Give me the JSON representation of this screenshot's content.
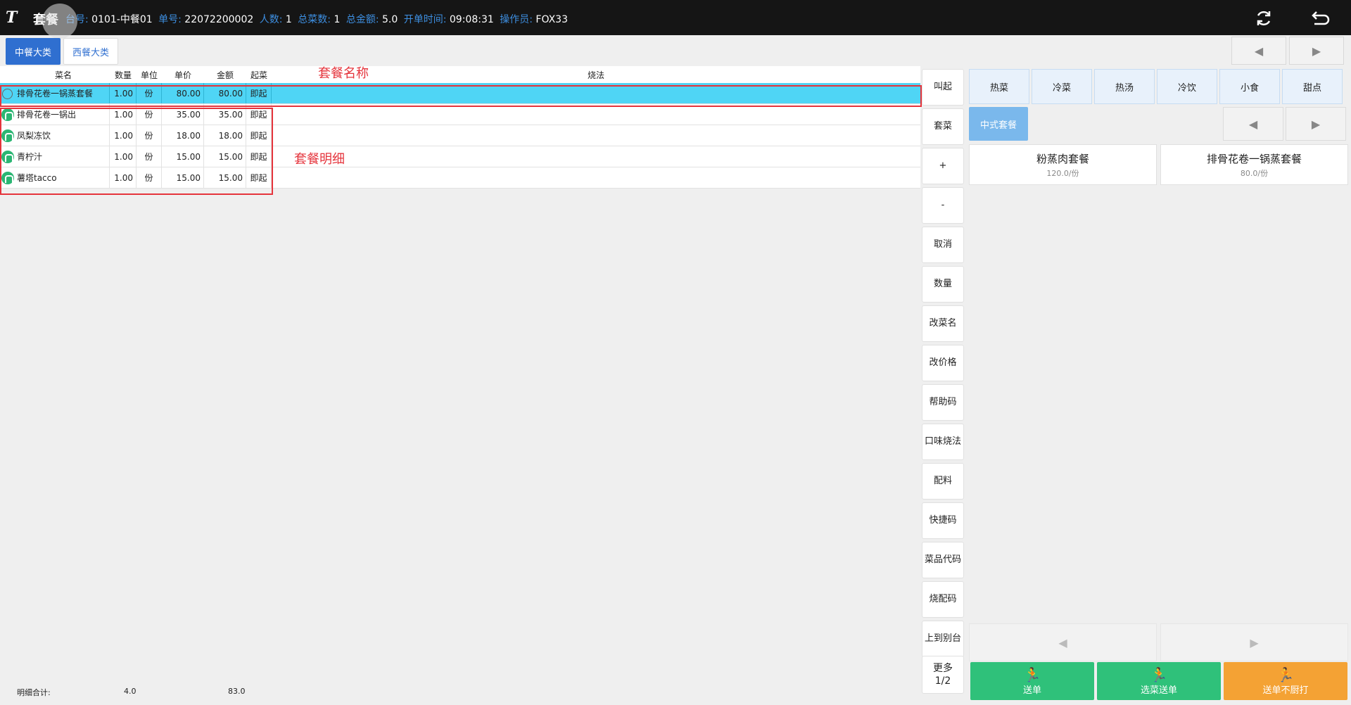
{
  "header": {
    "logo": "T",
    "title": "套餐",
    "info": [
      {
        "label": "台号:",
        "value": "0101-中餐01"
      },
      {
        "label": "单号:",
        "value": "22072200002"
      },
      {
        "label": "人数:",
        "value": "1"
      },
      {
        "label": "总菜数:",
        "value": "1"
      },
      {
        "label": "总金额:",
        "value": "5.0"
      },
      {
        "label": "开单时间:",
        "value": "09:08:31"
      },
      {
        "label": "操作员:",
        "value": "FOX33"
      }
    ],
    "refresh_icon": "refresh-icon",
    "back_icon": "back-icon"
  },
  "category_tabs": [
    {
      "label": "中餐大类",
      "active": true
    },
    {
      "label": "西餐大类",
      "active": false
    }
  ],
  "order_table": {
    "columns": {
      "name": "菜名",
      "qty": "数量",
      "unit": "单位",
      "price": "单价",
      "amount": "金额",
      "serve": "起菜",
      "method": "烧法"
    },
    "rows": [
      {
        "name": "排骨花卷一锅蒸套餐",
        "qty": "1.00",
        "unit": "份",
        "price": "80.00",
        "amount": "80.00",
        "serve": "即起",
        "method": "",
        "type": "set",
        "selected": true
      },
      {
        "name": "排骨花卷一锅出",
        "qty": "1.00",
        "unit": "份",
        "price": "35.00",
        "amount": "35.00",
        "serve": "即起",
        "method": "",
        "type": "dish",
        "selected": false
      },
      {
        "name": "凤梨冻饮",
        "qty": "1.00",
        "unit": "份",
        "price": "18.00",
        "amount": "18.00",
        "serve": "即起",
        "method": "",
        "type": "dish",
        "selected": false
      },
      {
        "name": "青柠汁",
        "qty": "1.00",
        "unit": "份",
        "price": "15.00",
        "amount": "15.00",
        "serve": "即起",
        "method": "",
        "type": "dish",
        "selected": false
      },
      {
        "name": "薯塔tacco",
        "qty": "1.00",
        "unit": "份",
        "price": "15.00",
        "amount": "15.00",
        "serve": "即起",
        "method": "",
        "type": "dish",
        "selected": false
      }
    ],
    "totals": {
      "label": "明细合计:",
      "qty": "4.0",
      "amount": "83.0"
    }
  },
  "annotations": {
    "set_name": "套餐名称",
    "set_detail": "套餐明细"
  },
  "actions": [
    "叫起",
    "套菜",
    "+",
    "-",
    "取消",
    "数量",
    "改菜名",
    "改价格",
    "帮助码",
    "口味烧法",
    "配料",
    "快捷码",
    "菜品代码",
    "烧配码",
    "上到别台"
  ],
  "more_button": {
    "line1": "更多",
    "line2": "1/2"
  },
  "dish_types": [
    "热菜",
    "冷菜",
    "热汤",
    "冷饮",
    "小食",
    "甜点"
  ],
  "sub_category": "中式套餐",
  "dishes": [
    {
      "name": "粉蒸肉套餐",
      "price": "120.0/份"
    },
    {
      "name": "排骨花卷一锅蒸套餐",
      "price": "80.0/份"
    }
  ],
  "send_buttons": [
    {
      "label": "送单",
      "color": "#2fc17a"
    },
    {
      "label": "选菜送单",
      "color": "#2fc17a"
    },
    {
      "label": "送单不厨打",
      "color": "#f4a234"
    }
  ],
  "pager": {
    "prev": "◀",
    "next": "▶"
  }
}
